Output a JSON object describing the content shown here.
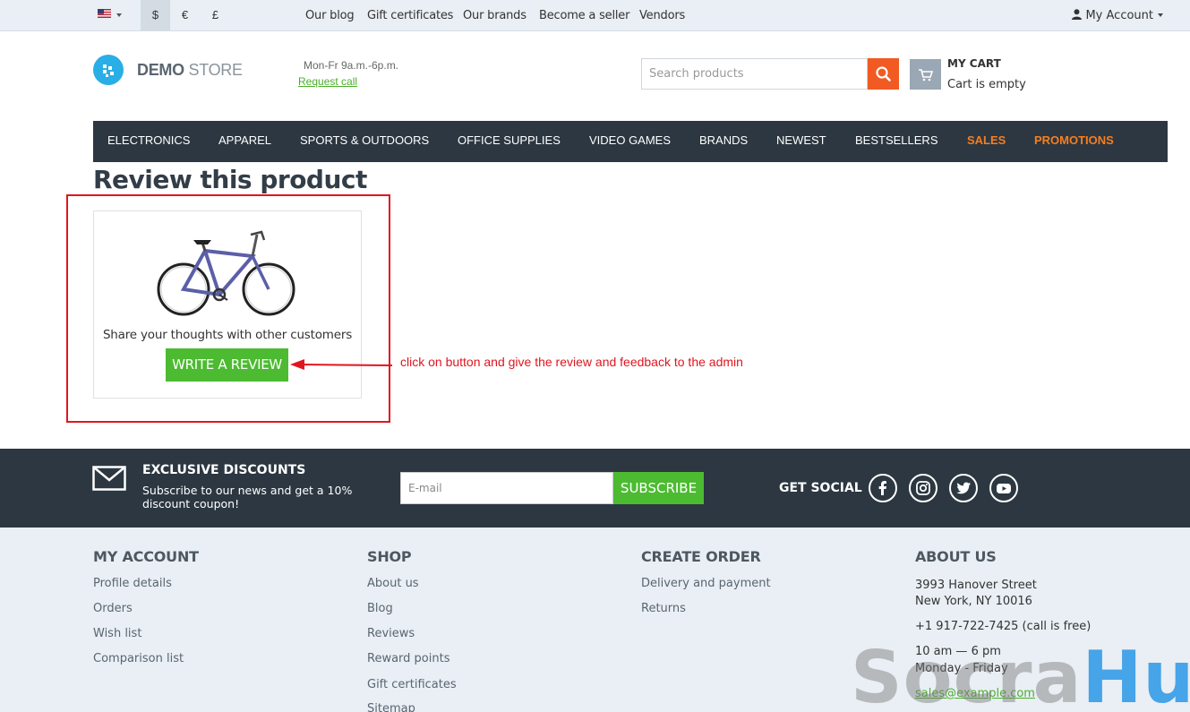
{
  "topbar": {
    "currencies": [
      "$",
      "€",
      "£"
    ],
    "links": [
      "Our blog",
      "Gift certificates",
      "Our brands",
      "Become a seller",
      "Vendors"
    ],
    "account_label": "My Account"
  },
  "header": {
    "logo_bold": "DEMO",
    "logo_light": "STORE",
    "hours": "Mon-Fr 9a.m.-6p.m.",
    "request_call": "Request call",
    "search_placeholder": "Search products",
    "cart_title": "MY CART",
    "cart_status": "Cart is empty"
  },
  "nav": {
    "items": [
      "ELECTRONICS",
      "APPAREL",
      "SPORTS & OUTDOORS",
      "OFFICE SUPPLIES",
      "VIDEO GAMES",
      "BRANDS",
      "NEWEST",
      "BESTSELLERS",
      "SALES",
      "PROMOTIONS"
    ]
  },
  "review": {
    "title": "Review this product",
    "share_text": "Share your thoughts with other customers",
    "button_label": "WRITE A REVIEW",
    "annotation": "click on button and give the review and feedback to the admin"
  },
  "newsletter": {
    "title": "EXCLUSIVE DISCOUNTS",
    "subtitle": "Subscribe to our news and get a 10% discount coupon!",
    "email_placeholder": "E-mail",
    "subscribe_label": "SUBSCRIBE",
    "social_title": "GET SOCIAL"
  },
  "footer": {
    "my_account": {
      "title": "MY ACCOUNT",
      "links": [
        "Profile details",
        "Orders",
        "Wish list",
        "Comparison list"
      ]
    },
    "shop": {
      "title": "SHOP",
      "links": [
        "About us",
        "Blog",
        "Reviews",
        "Reward points",
        "Gift certificates",
        "Sitemap"
      ]
    },
    "create_order": {
      "title": "CREATE ORDER",
      "links": [
        "Delivery and payment",
        "Returns"
      ]
    },
    "about_us": {
      "title": "ABOUT US",
      "address_line1": "3993 Hanover Street",
      "address_line2": "New York, NY 10016",
      "phone": "+1 917-722-7425 (call is free)",
      "hours": "10 am — 6 pm",
      "days": "Monday - Friday",
      "email": "sales@example.com"
    }
  },
  "watermark": {
    "part1": "Socra",
    "part2": "Hub"
  },
  "colors": {
    "accent_green": "#4cbb31",
    "accent_orange": "#f57f1f",
    "nav_bg": "#2c3741",
    "annotation_red": "#e0161f"
  }
}
